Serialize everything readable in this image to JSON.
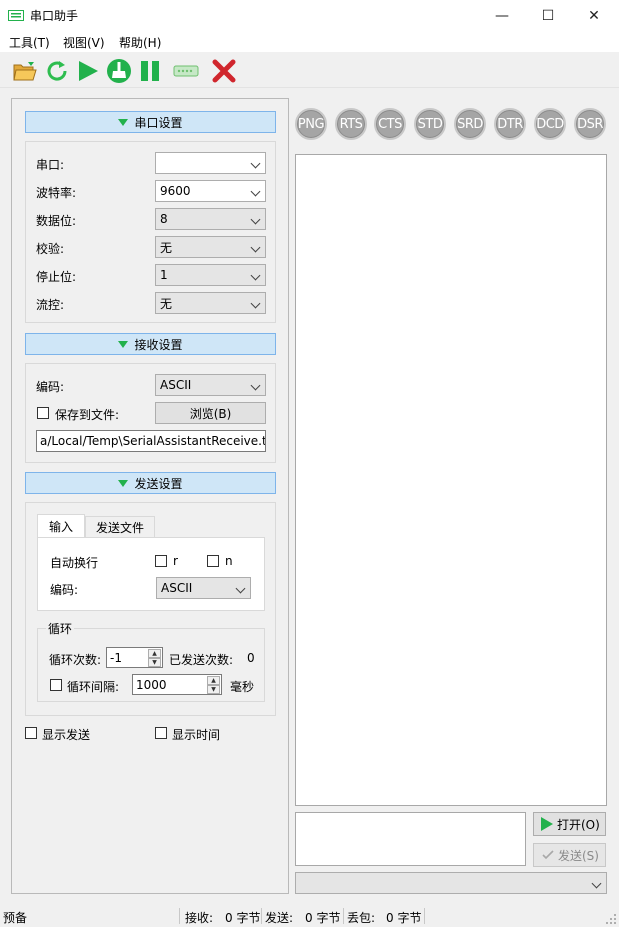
{
  "window": {
    "title": "串口助手",
    "minimize": "—",
    "maximize": "☐",
    "close": "✕"
  },
  "menu": [
    "工具(T)",
    "视图(V)",
    "帮助(H)"
  ],
  "toolbar": {
    "icons": [
      "open-folder-icon",
      "refresh-icon",
      "start-icon",
      "clear-icon",
      "pause-icon",
      "port-icon",
      "close-port-icon"
    ]
  },
  "serial": {
    "header": "串口设置",
    "port_label": "串口:",
    "port_value": "",
    "baud_label": "波特率:",
    "baud_value": "9600",
    "databits_label": "数据位:",
    "databits_value": "8",
    "parity_label": "校验:",
    "parity_value": "无",
    "stopbits_label": "停止位:",
    "stopbits_value": "1",
    "flow_label": "流控:",
    "flow_value": "无"
  },
  "receive": {
    "header": "接收设置",
    "encoding_label": "编码:",
    "encoding_value": "ASCII",
    "save_label": "保存到文件:",
    "browse_label": "浏览(B)",
    "path_value": "a/Local/Temp\\SerialAssistantReceive.txt"
  },
  "send": {
    "header": "发送设置",
    "tab_input": "输入",
    "tab_file": "发送文件",
    "autonewline_label": "自动换行",
    "r_label": "r",
    "n_label": "n",
    "encoding_label": "编码:",
    "encoding_value": "ASCII",
    "loop_title": "循环",
    "loop_count_label": "循环次数:",
    "loop_count_value": "-1",
    "sent_count_label": "已发送次数:",
    "sent_count_value": "0",
    "loop_interval_label": "循环间隔:",
    "loop_interval_value": "1000",
    "ms_label": "毫秒"
  },
  "display": {
    "show_send_label": "显示发送",
    "show_time_label": "显示时间"
  },
  "signals": [
    "PNG",
    "RTS",
    "CTS",
    "STD",
    "SRD",
    "DTR",
    "DCD",
    "DSR"
  ],
  "actions": {
    "open_label": "打开(O)",
    "send_label": "发送(S)"
  },
  "status": {
    "ready": "预备",
    "recv_label": "接收:",
    "recv_value": "0 字节",
    "send_label": "发送:",
    "send_value": "0 字节",
    "lost_label": "丢包:",
    "lost_value": "0 字节"
  },
  "colors": {
    "accent_green": "#22b14c",
    "header_blue": "#cfe6f7",
    "close_red": "#d0262d"
  }
}
